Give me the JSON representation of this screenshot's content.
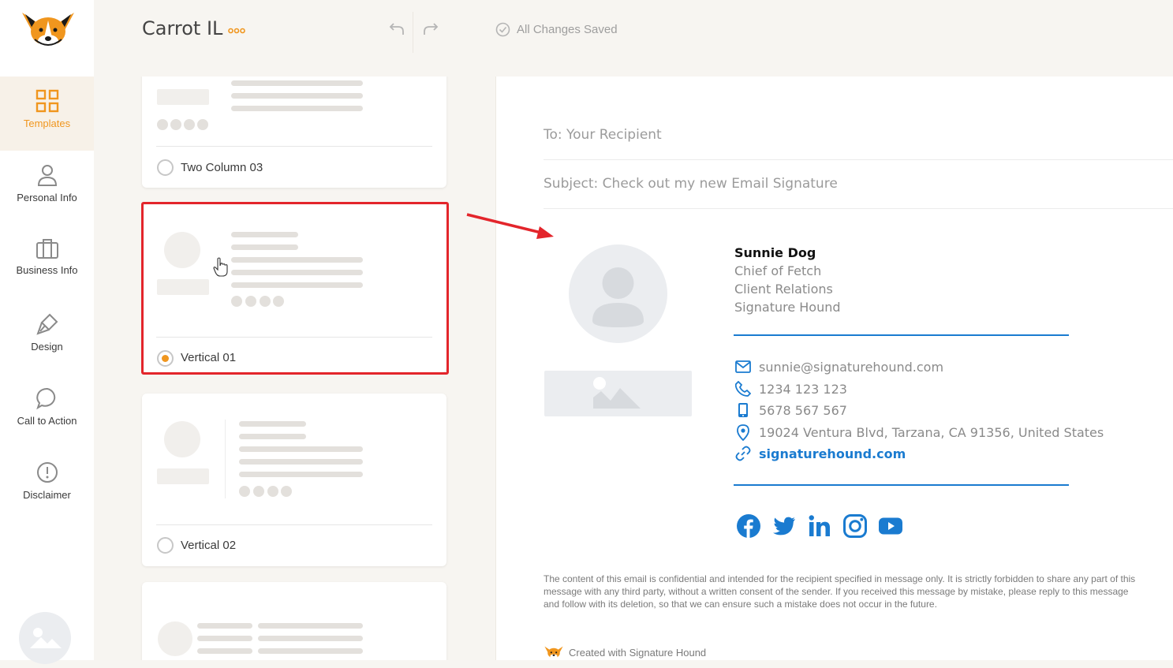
{
  "app": {
    "logo": "signature-hound-dog-logo"
  },
  "sidebar": {
    "items": [
      {
        "label": "Templates",
        "icon": "grid-icon",
        "active": true
      },
      {
        "label": "Personal Info",
        "icon": "person-icon"
      },
      {
        "label": "Business Info",
        "icon": "briefcase-icon"
      },
      {
        "label": "Design",
        "icon": "brush-icon"
      },
      {
        "label": "Call to Action",
        "icon": "chat-bubble-icon"
      },
      {
        "label": "Disclaimer",
        "icon": "exclamation-icon"
      }
    ]
  },
  "header": {
    "title": "Carrot IL",
    "more_icon": "more-dots-icon",
    "undo_icon": "undo-icon",
    "redo_icon": "redo-icon",
    "status": "All Changes Saved"
  },
  "templates": [
    {
      "label": "Two Column 03",
      "selected": false
    },
    {
      "label": "Vertical 01",
      "selected": true
    },
    {
      "label": "Vertical 02",
      "selected": false
    }
  ],
  "preview": {
    "to": "To: Your Recipient",
    "subject": "Subject: Check out my new Email Signature",
    "name": "Sunnie Dog",
    "job_title": "Chief of Fetch",
    "department": "Client Relations",
    "company": "Signature Hound",
    "email": "sunnie@signaturehound.com",
    "phone": "1234 123 123",
    "mobile": "5678 567 567",
    "address": "19024 Ventura Blvd, Tarzana, CA 91356, United States",
    "website": "signaturehound.com",
    "socials": [
      "facebook-icon",
      "twitter-icon",
      "linkedin-icon",
      "instagram-icon",
      "youtube-icon"
    ],
    "disclaimer": "The content of this email is confidential and intended for the recipient specified in message only. It is strictly forbidden to share any part of this message with any third party, without a written consent of the sender. If you received this message by mistake, please reply to this message and follow with its deletion, so that we can ensure such a mistake does not occur in the future.",
    "credit": "Created with Signature Hound"
  },
  "colors": {
    "accent": "#f0961e",
    "link": "#1a7bd0",
    "highlight": "#e3252b"
  }
}
